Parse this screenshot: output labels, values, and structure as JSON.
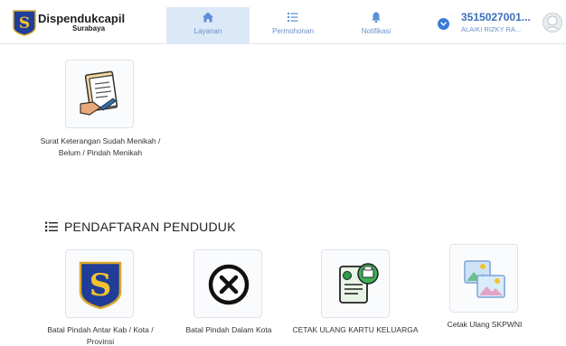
{
  "header": {
    "brand": "Dispendukcapil",
    "brand_sub": "Surabaya",
    "nav": [
      {
        "label": "Layanan",
        "icon": "home-icon",
        "active": true
      },
      {
        "label": "Permohonan",
        "icon": "list-icon",
        "active": false
      },
      {
        "label": "Notifikasi",
        "icon": "bell-icon",
        "active": false
      }
    ],
    "user": {
      "id": "3515027001...",
      "name": "ALAIKI RIZKY RA..."
    }
  },
  "top_service": {
    "label": "Surat Keterangan Sudah Menikah / Belum / Pindah Menikah",
    "icon": "document-sign-icon"
  },
  "section": {
    "title": "PENDAFTARAN PENDUDUK",
    "icon": "list-icon"
  },
  "services": [
    {
      "label": "Batal Pindah Antar Kab / Kota / Provinsi",
      "icon": "surabaya-emblem-icon"
    },
    {
      "label": "Batal Pindah Dalam Kota",
      "icon": "cancel-circle-icon"
    },
    {
      "label": "CETAK ULANG KARTU KELUARGA",
      "icon": "print-document-icon"
    },
    {
      "label": "Cetak Ulang SKPWNI",
      "icon": "image-documents-icon"
    }
  ],
  "colors": {
    "accent": "#3b7dd8",
    "nav_active_bg": "#dbe8f8",
    "nav_text": "#6a8fc7"
  }
}
